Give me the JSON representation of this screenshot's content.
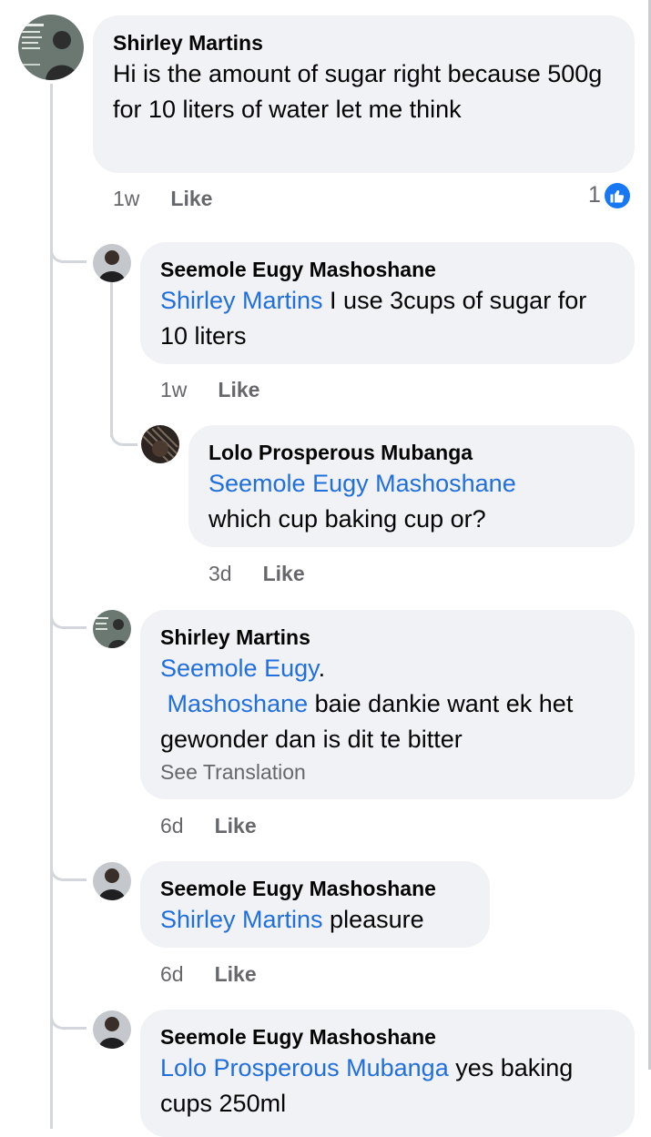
{
  "comments": [
    {
      "author": "Shirley Martins",
      "text": "Hi is  the amount of sugar right because 500g for 10 liters of water let me think",
      "time": "1w",
      "like": "Like",
      "reaction_count": "1"
    },
    {
      "author": "Seemole Eugy Mashoshane",
      "mention": "Shirley Martins",
      "text": " I use 3cups of sugar for 10 liters",
      "time": "1w",
      "like": "Like"
    },
    {
      "author": "Lolo Prosperous Mubanga",
      "mention": "Seemole Eugy Mashoshane",
      "text": "which cup baking cup or?",
      "time": "3d",
      "like": "Like"
    },
    {
      "author": "Shirley Martins",
      "mention": "Seemole Eugy",
      "mention_punct": ".",
      "mention2": "Mashoshane",
      "text": " baie dankie want ek het gewonder dan is dit te bitter",
      "see_translation": "See Translation",
      "time": "6d",
      "like": "Like"
    },
    {
      "author": "Seemole Eugy Mashoshane",
      "mention": "Shirley Martins",
      "text": " pleasure",
      "time": "6d",
      "like": "Like"
    },
    {
      "author": "Seemole Eugy Mashoshane",
      "mention": "Lolo Prosperous Mubanga",
      "text": " yes baking cups 250ml"
    }
  ],
  "colors": {
    "bubble": "#f0f2f5",
    "mention": "#216fdb",
    "meta": "#65676b",
    "like_badge": "#1877f2"
  }
}
